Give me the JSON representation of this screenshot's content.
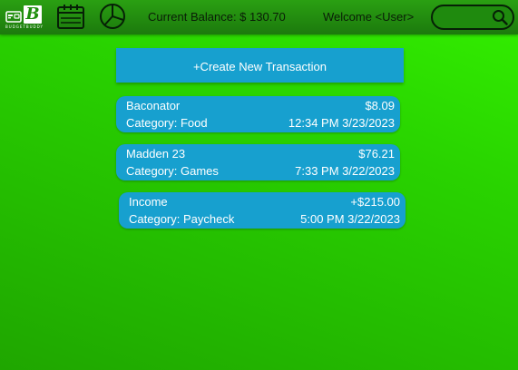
{
  "app": {
    "logo_letter": "B",
    "logo_tagline": "BUDGETBUDDY"
  },
  "nav": {
    "icons": [
      "wallet-icon",
      "calendar-icon",
      "pie-chart-icon",
      "search-icon"
    ]
  },
  "header": {
    "balance_text": "Current Balance: $ 130.70",
    "welcome_text": "Welcome <User>",
    "search_value": ""
  },
  "actions": {
    "create_label": "+Create New Transaction"
  },
  "transactions": [
    {
      "name": "Baconator",
      "amount": "$8.09",
      "category": "Category: Food",
      "timestamp": "12:34 PM 3/23/2023"
    },
    {
      "name": "Madden 23",
      "amount": "$76.21",
      "category": "Category: Games",
      "timestamp": "7:33 PM 3/22/2023"
    },
    {
      "name": "Income",
      "amount": "+$215.00",
      "category": "Category: Paycheck",
      "timestamp": "5:00 PM 3/22/2023"
    }
  ],
  "colors": {
    "background_green": "#29d300",
    "topbar_green": "#1c7a0d",
    "card_blue": "#17a0cf",
    "text_white": "#ffffff",
    "text_dark": "#0a1d07"
  }
}
